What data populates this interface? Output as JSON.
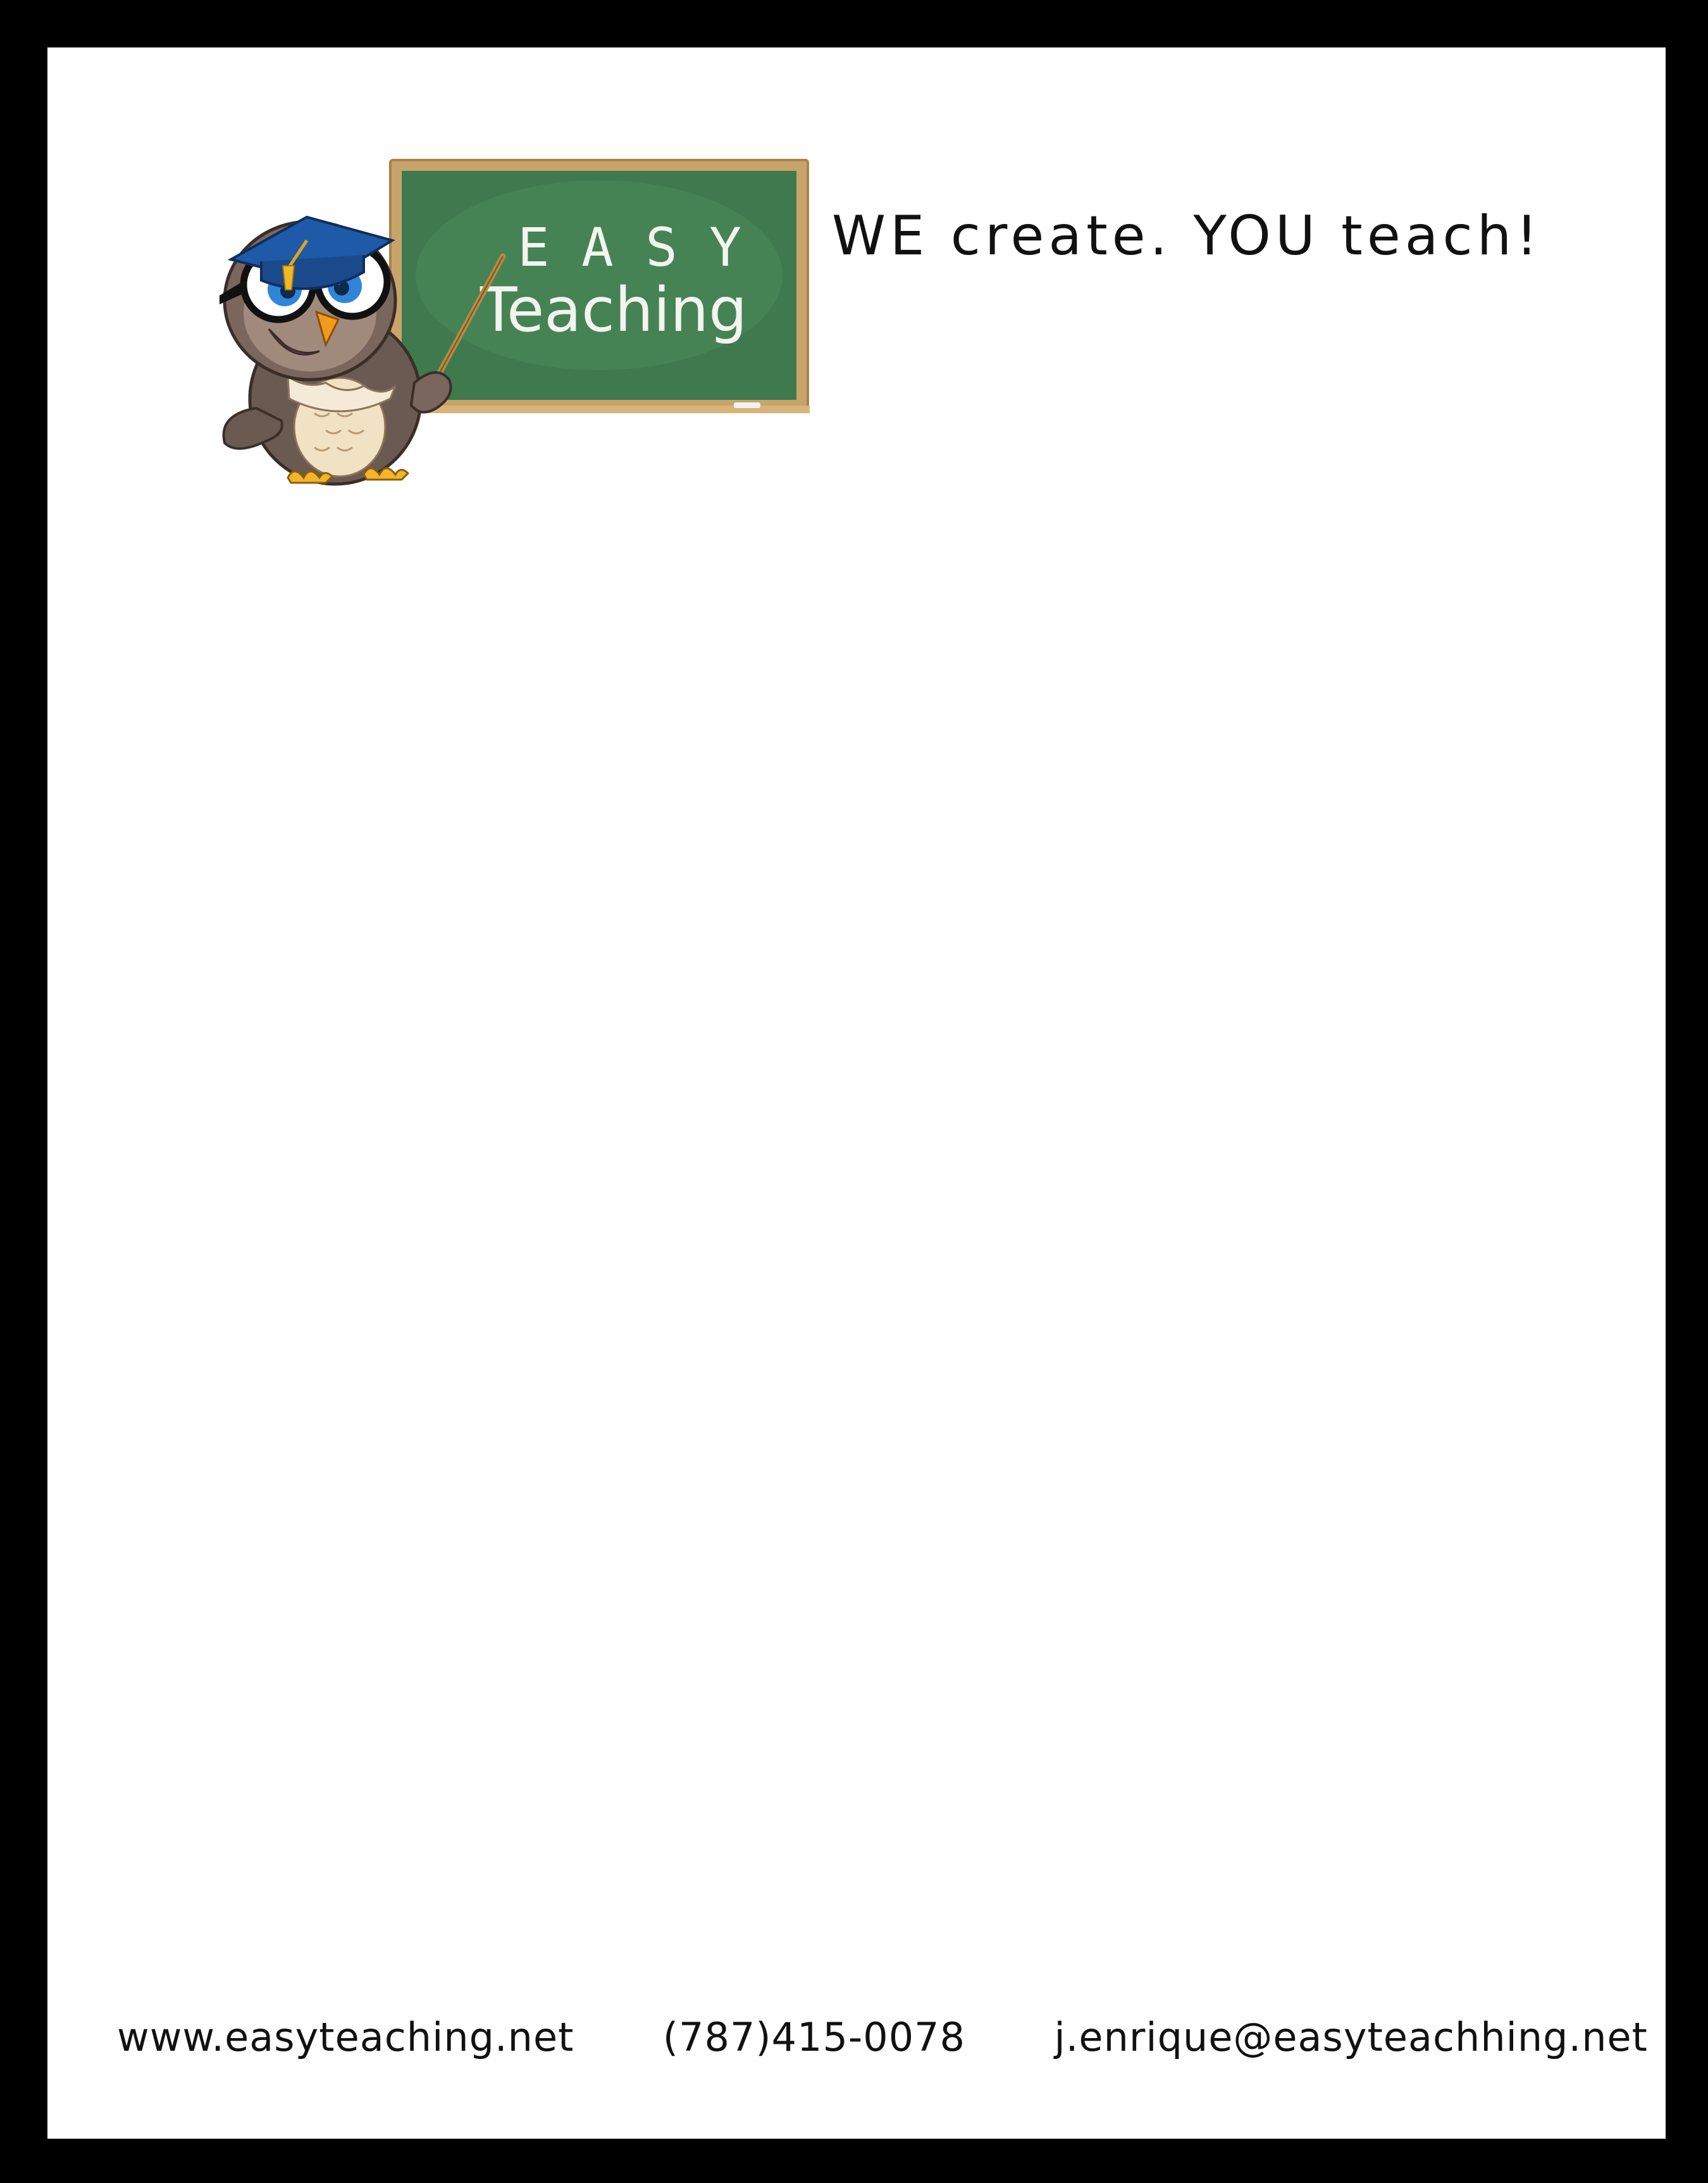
{
  "logo": {
    "board_line1": "E A S Y",
    "board_line2": "Teaching"
  },
  "tagline": "WE create. YOU teach!",
  "footer": {
    "website": "www.easyteaching.net",
    "phone": "(787)415-0078",
    "email": "j.enrique@easyteachhing.net"
  },
  "colors": {
    "page_border": "#000000",
    "chalkboard": "#3e7a4e",
    "board_frame": "#c9a46a",
    "owl_body": "#6b5a52",
    "cap": "#1f5aa8"
  }
}
